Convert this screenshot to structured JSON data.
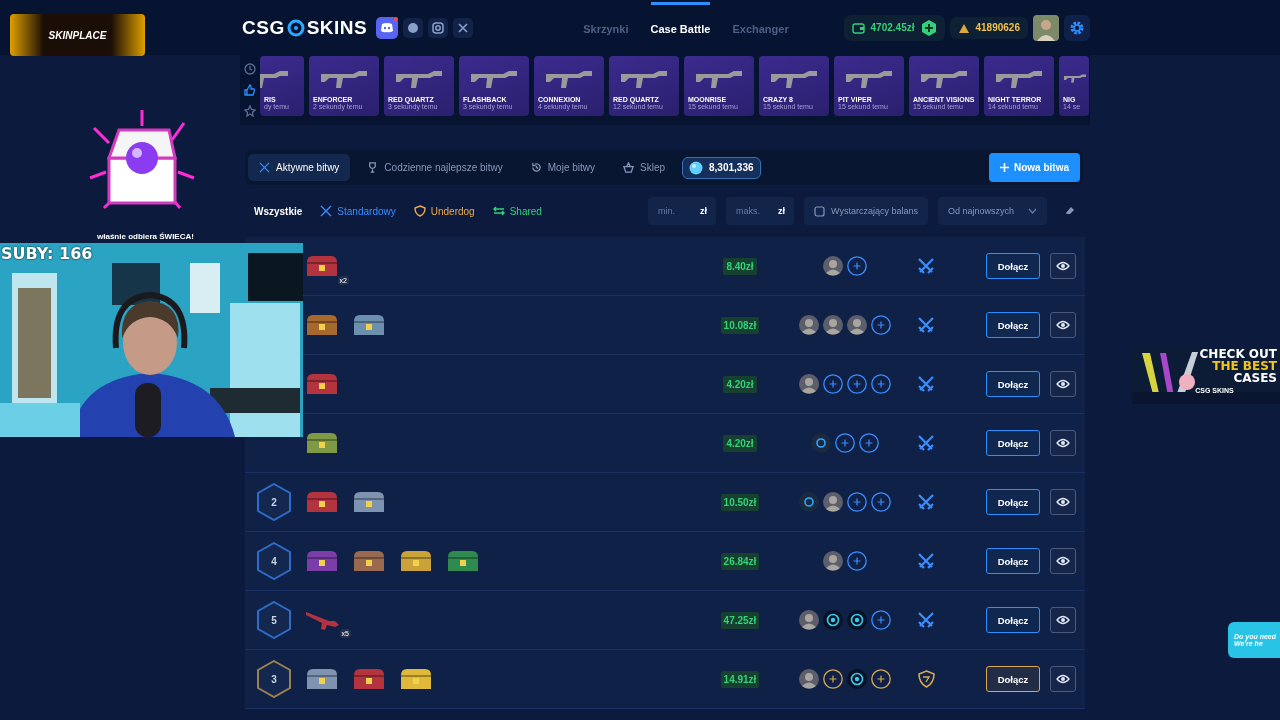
{
  "overlay": {
    "sponsor": "SKINPLACE",
    "subs": "SUBY: 166",
    "alert": "właśnie odbiera ŚWIECA!",
    "ad_lines": [
      "CHECK OUT",
      "THE BEST",
      "CASES"
    ],
    "ad_brand": [
      "CSG",
      "SKINS"
    ],
    "chat_lines": [
      "Do you need",
      "We're he"
    ]
  },
  "header": {
    "logo": [
      "CSG",
      "SKINS"
    ],
    "nav": [
      {
        "label": "Skrzynki",
        "selected": false
      },
      {
        "label": "Case Battle",
        "selected": true
      },
      {
        "label": "Exchanger",
        "selected": false
      }
    ],
    "balance": "4702.45zł",
    "coins": "41890626"
  },
  "live_drops": {
    "side": [
      {
        "kind": "recent",
        "selected": false
      },
      {
        "kind": "top",
        "selected": true
      },
      {
        "kind": "favorite",
        "selected": false
      }
    ],
    "items": [
      {
        "name": "RIS",
        "time": "dy temu"
      },
      {
        "name": "ENFORCER",
        "time": "2 sekundy temu"
      },
      {
        "name": "RED QUARTZ",
        "time": "3 sekundy temu"
      },
      {
        "name": "FLASHBACK",
        "time": "3 sekundy temu"
      },
      {
        "name": "CONNEXION",
        "time": "4 sekundy temu"
      },
      {
        "name": "RED QUARTZ",
        "time": "12 sekund temu"
      },
      {
        "name": "MOONRISE",
        "time": "15 sekund temu"
      },
      {
        "name": "CRAZY 8",
        "time": "15 sekund temu"
      },
      {
        "name": "PIT VIPER",
        "time": "15 sekund temu"
      },
      {
        "name": "ANCIENT VISIONS",
        "time": "15 sekund temu"
      },
      {
        "name": "NIGHT TERROR",
        "time": "14 sekund temu"
      },
      {
        "name": "NIG",
        "time": "14 se"
      }
    ]
  },
  "tabs": [
    {
      "label": "Aktywne bitwy",
      "kind": "active",
      "selected": true
    },
    {
      "label": "Codzienne najlepsze bitwy",
      "kind": "best",
      "selected": false
    },
    {
      "label": "Moje bitwy",
      "kind": "mine",
      "selected": false
    },
    {
      "label": "Sklep",
      "kind": "shop",
      "selected": false
    }
  ],
  "gems": "8,301,336",
  "new_battle": "Nowa bitwa",
  "filters": [
    {
      "label": "Wszystkie",
      "kind": "all",
      "color": "#ffffff",
      "selected": true
    },
    {
      "label": "Standardowy",
      "kind": "standard",
      "color": "#3b8cff",
      "selected": false
    },
    {
      "label": "Underdog",
      "kind": "underdog",
      "color": "#f0a94a",
      "selected": false
    },
    {
      "label": "Shared",
      "kind": "shared",
      "color": "#34d17a",
      "selected": false
    }
  ],
  "min": {
    "placeholder": "min.",
    "unit": "zł"
  },
  "max": {
    "placeholder": "maks.",
    "unit": "zł"
  },
  "enough_balance": {
    "label": "Wystarczający balans",
    "checked": false
  },
  "sort": "Od najnowszych",
  "battles": [
    {
      "cases": [
        {
          "kind": "case",
          "color": "#b3333f",
          "badge": "x2"
        }
      ],
      "price": "8.40zł",
      "players": [
        {
          "kind": "avatar"
        },
        {
          "kind": "empty"
        }
      ],
      "kind": "standard",
      "join": "Dołącz"
    },
    {
      "cases": [
        {
          "kind": "case",
          "color": "#a8692e"
        },
        {
          "kind": "case",
          "color": "#6d8fae"
        }
      ],
      "price": "10.08zł",
      "players": [
        {
          "kind": "avatar"
        },
        {
          "kind": "avatar"
        },
        {
          "kind": "avatar"
        },
        {
          "kind": "empty"
        }
      ],
      "kind": "standard",
      "join": "Dołącz"
    },
    {
      "cases": [
        {
          "kind": "case",
          "color": "#b3333f"
        }
      ],
      "price": "4.20zł",
      "players": [
        {
          "kind": "avatar"
        },
        {
          "kind": "empty"
        },
        {
          "kind": "empty"
        },
        {
          "kind": "empty"
        }
      ],
      "kind": "standard",
      "join": "Dołącz"
    },
    {
      "cases": [
        {
          "kind": "case",
          "color": "#7f9a45"
        }
      ],
      "price": "4.20zł",
      "players": [
        {
          "kind": "site"
        },
        {
          "kind": "empty"
        },
        {
          "kind": "empty"
        }
      ],
      "kind": "standard",
      "join": "Dołącz"
    },
    {
      "round": "2",
      "cases": [
        {
          "kind": "case",
          "color": "#b3333f"
        },
        {
          "kind": "case",
          "color": "#7d93b0"
        }
      ],
      "price": "10.50zł",
      "players": [
        {
          "kind": "site"
        },
        {
          "kind": "avatar"
        },
        {
          "kind": "empty"
        },
        {
          "kind": "empty"
        }
      ],
      "kind": "standard",
      "join": "Dołącz"
    },
    {
      "round": "4",
      "cases": [
        {
          "kind": "case",
          "color": "#7b3ea8"
        },
        {
          "kind": "case",
          "color": "#9a6a50"
        },
        {
          "kind": "case",
          "color": "#c9a23a"
        },
        {
          "kind": "case",
          "color": "#2e8a4e"
        }
      ],
      "price": "26.84zł",
      "players": [
        {
          "kind": "avatar"
        },
        {
          "kind": "empty"
        }
      ],
      "kind": "standard",
      "join": "Dołącz"
    },
    {
      "round": "5",
      "cases": [
        {
          "kind": "weapon",
          "color": "#b3333f",
          "badge": "x5"
        }
      ],
      "price": "47.25zł",
      "players": [
        {
          "kind": "avatar"
        },
        {
          "kind": "bot"
        },
        {
          "kind": "bot"
        },
        {
          "kind": "empty"
        }
      ],
      "kind": "standard",
      "join": "Dołącz"
    },
    {
      "round": "3",
      "cases": [
        {
          "kind": "case",
          "color": "#7d93b0"
        },
        {
          "kind": "case",
          "color": "#b3333f"
        },
        {
          "kind": "case",
          "color": "#e0b83a"
        }
      ],
      "price": "14.91zł",
      "players": [
        {
          "kind": "avatar"
        },
        {
          "kind": "empty"
        },
        {
          "kind": "bot"
        },
        {
          "kind": "empty"
        }
      ],
      "kind": "underdog",
      "join": "Dołącz"
    }
  ]
}
